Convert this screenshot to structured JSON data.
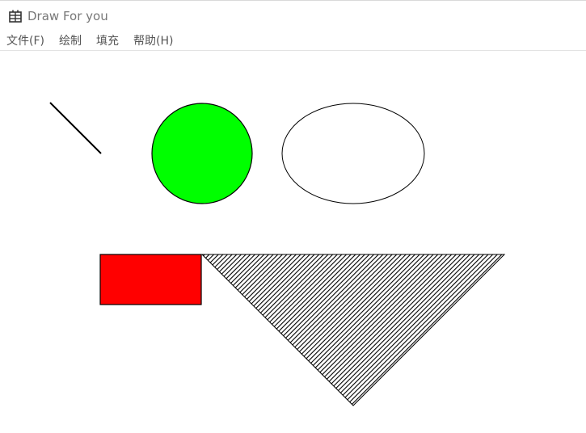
{
  "window": {
    "title": "Draw For you",
    "app_icon": "calendar-grid-icon"
  },
  "menubar": {
    "items": [
      {
        "label": "文件(F)"
      },
      {
        "label": "绘制"
      },
      {
        "label": "填充"
      },
      {
        "label": "帮助(H)"
      }
    ]
  },
  "canvas": {
    "shapes": [
      {
        "kind": "line",
        "stroke": "#000000"
      },
      {
        "kind": "circle",
        "fill": "#00ff00",
        "stroke": "#000000"
      },
      {
        "kind": "ellipse",
        "fill": "#ffffff",
        "stroke": "#000000"
      },
      {
        "kind": "rectangle",
        "fill": "#ff0000",
        "stroke": "#000000"
      },
      {
        "kind": "triangle",
        "fill": "diagonal-hatch",
        "hatch_color": "#000000",
        "stroke": "#000000"
      }
    ]
  }
}
